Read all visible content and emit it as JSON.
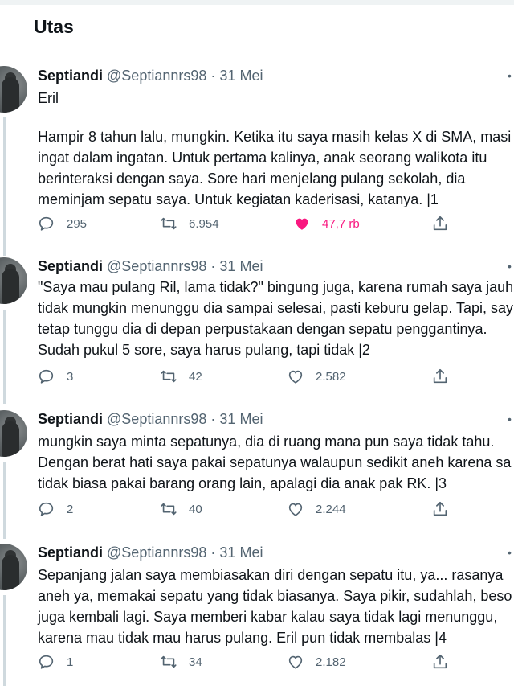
{
  "page": {
    "title": "Utas"
  },
  "tweets": [
    {
      "name": "Septiandi",
      "handle": "@Septiannrs98",
      "dot": "·",
      "date": "31 Mei",
      "lines": [
        "Eril",
        "",
        "Hampir 8 tahun lalu, mungkin. Ketika itu saya masih kelas X di SMA, masi",
        "ingat dalam ingatan. Untuk pertama kalinya, anak seorang walikota itu",
        "berinteraksi dengan saya. Sore hari menjelang pulang sekolah, dia",
        "meminjam sepatu saya. Untuk kegiatan kaderisasi, katanya. |1"
      ],
      "replies": "295",
      "retweets": "6.954",
      "likes": "47,7 rb",
      "liked": true
    },
    {
      "name": "Septiandi",
      "handle": "@Septiannrs98",
      "dot": "·",
      "date": "31 Mei",
      "lines": [
        "\"Saya mau pulang Ril, lama tidak?\" bingung juga, karena rumah saya jauh,",
        "tidak mungkin menunggu dia sampai selesai, pasti keburu gelap. Tapi, say",
        "tetap tunggu dia di depan perpustakaan dengan sepatu penggantinya.",
        "Sudah pukul 5 sore, saya harus pulang, tapi tidak |2"
      ],
      "replies": "3",
      "retweets": "42",
      "likes": "2.582",
      "liked": false
    },
    {
      "name": "Septiandi",
      "handle": "@Septiannrs98",
      "dot": "·",
      "date": "31 Mei",
      "lines": [
        "mungkin saya minta sepatunya, dia di ruang mana pun saya tidak tahu.",
        "Dengan berat hati saya pakai sepatunya walaupun sedikit aneh karena sa",
        "tidak biasa pakai barang orang lain, apalagi dia anak pak RK. |3"
      ],
      "replies": "2",
      "retweets": "40",
      "likes": "2.244",
      "liked": false
    },
    {
      "name": "Septiandi",
      "handle": "@Septiannrs98",
      "dot": "·",
      "date": "31 Mei",
      "lines": [
        "Sepanjang jalan saya membiasakan diri dengan sepatu itu, ya... rasanya",
        "aneh ya, memakai sepatu yang tidak biasanya. Saya pikir, sudahlah, beso",
        "juga kembali lagi. Saya memberi kabar kalau saya tidak lagi menunggu,",
        "karena mau tidak mau harus pulang. Eril pun tidak membalas |4"
      ],
      "replies": "1",
      "retweets": "34",
      "likes": "2.182",
      "liked": false
    }
  ],
  "icons": {
    "reply": "reply-icon",
    "retweet": "retweet-icon",
    "like": "heart-icon",
    "share": "share-icon",
    "more": "more-icon"
  },
  "colors": {
    "like_active": "#f91880",
    "secondary_text": "#536471",
    "thread_line": "#cfd9de"
  }
}
